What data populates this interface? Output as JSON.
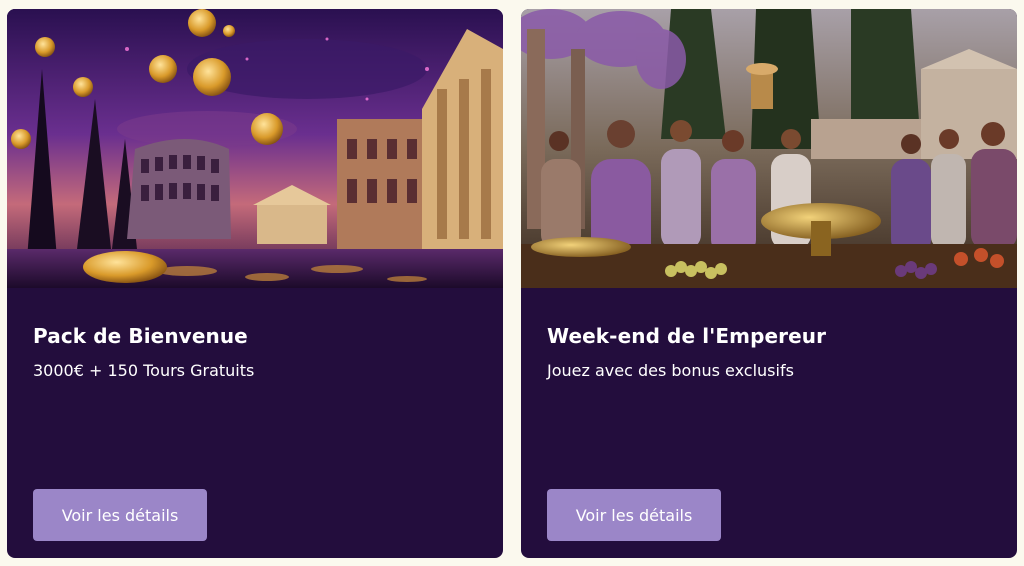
{
  "cards": [
    {
      "image_name": "roman-colosseum-gold-coins",
      "title": "Pack de Bienvenue",
      "subtitle": "3000€ + 150 Tours Gratuits",
      "button_label": "Voir les détails"
    },
    {
      "image_name": "roman-banquet-feast",
      "title": "Week-end de l'Empereur",
      "subtitle": "Jouez avec des bonus exclusifs",
      "button_label": "Voir les détails"
    }
  ],
  "colors": {
    "page_background": "#fbf9ee",
    "card_background": "#230d3d",
    "button_background": "#9b86c8",
    "text": "#ffffff"
  }
}
